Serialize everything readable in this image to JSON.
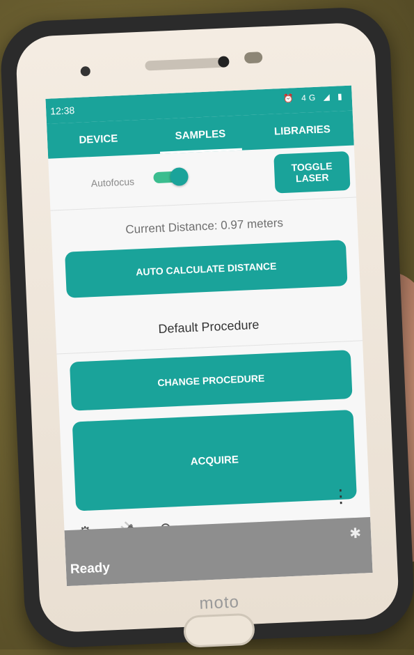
{
  "status_bar": {
    "time": "12:38",
    "icons": "⏰ 4G ◢ ▮"
  },
  "tabs": [
    {
      "label": "DEVICE"
    },
    {
      "label": "SAMPLES"
    },
    {
      "label": "LIBRARIES"
    }
  ],
  "autofocus": {
    "label": "Autofocus",
    "on": true
  },
  "toggle_laser_label": "TOGGLE LASER",
  "current_distance": "Current Distance: 0.97 meters",
  "auto_calc_label": "AUTO CALCULATE DISTANCE",
  "procedure_name": "Default Procedure",
  "change_procedure_label": "CHANGE PROCEDURE",
  "acquire_label": "ACQUIRE",
  "status_text": "Ready",
  "brand": "moto",
  "colors": {
    "accent": "#1aa39a",
    "status_bg": "#8e8e8e"
  },
  "icons": [
    "settings-icon",
    "plug-icon",
    "refresh-icon",
    "more-vert-icon",
    "bluetooth-icon"
  ]
}
